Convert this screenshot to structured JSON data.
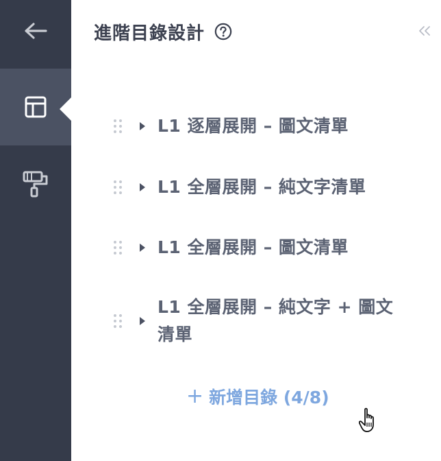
{
  "header": {
    "title": "進階目錄設計"
  },
  "toc": {
    "items": [
      {
        "label": "L1 逐層展開 – 圖文清單"
      },
      {
        "label": "L1 全層展開 – 純文字清單"
      },
      {
        "label": "L1 全層展開 – 圖文清單"
      },
      {
        "label_line1": "L1 全層展開 – 純文字 + 圖文",
        "label_line2": "清單"
      }
    ],
    "add_label": "新增目錄 (4/8)"
  },
  "icons": {
    "back": "arrow-left-icon",
    "layout": "layout-icon",
    "paint": "paint-roller-icon",
    "help": "question-circle-icon",
    "collapse": "double-chevron-left-icon",
    "drag": "drag-handle-icon",
    "caret": "caret-right-icon"
  },
  "colors": {
    "rail_bg": "#353b4a",
    "rail_active": "#4b5263",
    "accent": "#7ea7df",
    "text": "#5b6273"
  }
}
